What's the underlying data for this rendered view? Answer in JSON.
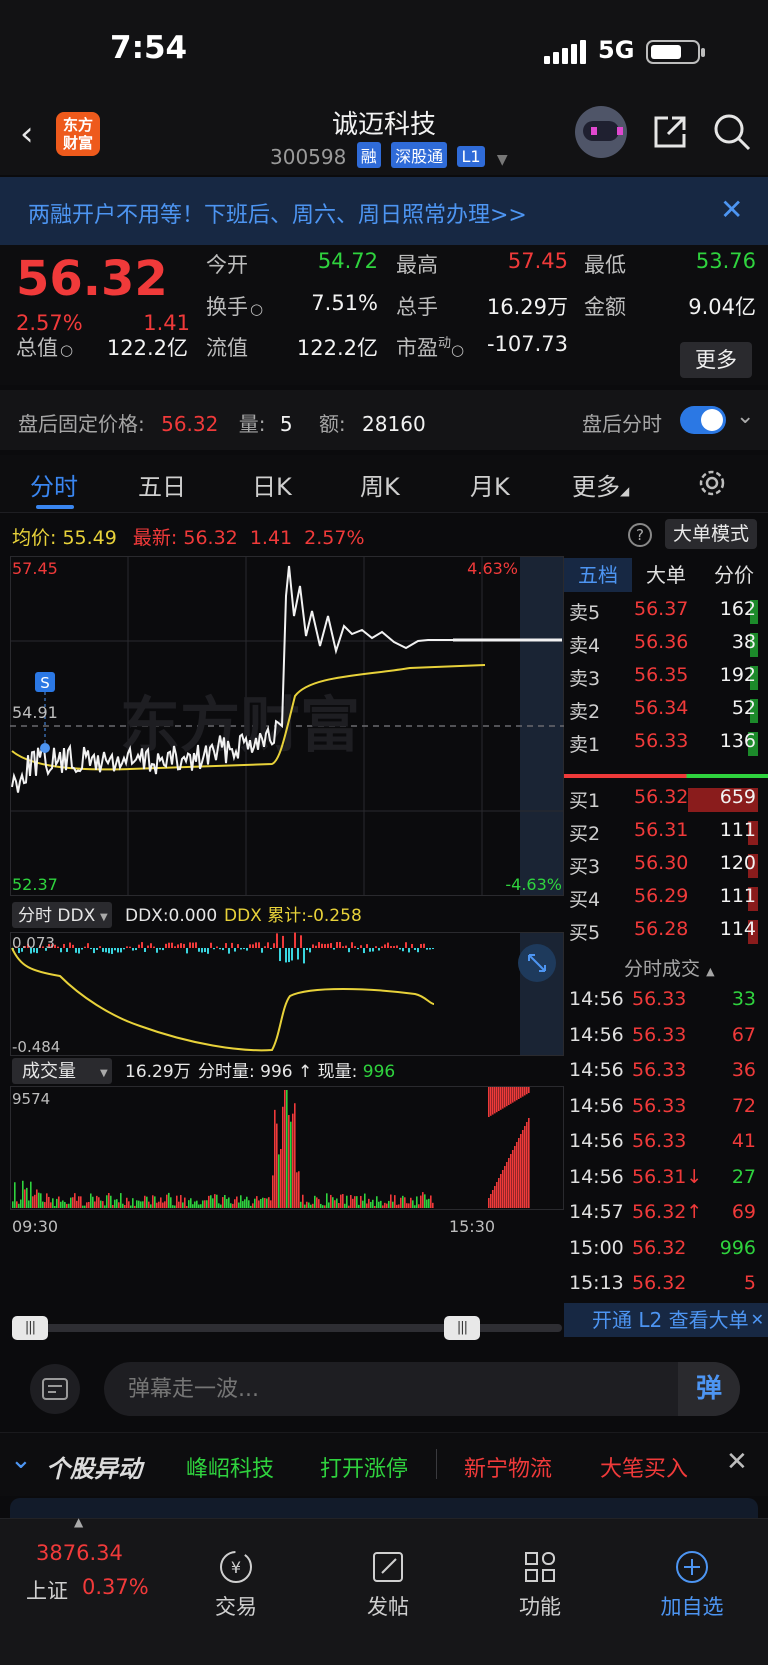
{
  "status_bar": {
    "time": "7:54",
    "network": "5G"
  },
  "header": {
    "title": "诚迈科技",
    "code": "300598",
    "tags": [
      "融",
      "深股通",
      "L1"
    ],
    "logo_text": "东方财富"
  },
  "banner": {
    "text": "两融开户不用等！下班后、周六、周日照常办理>>"
  },
  "quote": {
    "price": "56.32",
    "change_pct": "2.57%",
    "change": "1.41",
    "fields": [
      {
        "label": "今开",
        "value": "54.72",
        "color": "green"
      },
      {
        "label": "最高",
        "value": "57.45",
        "color": "red"
      },
      {
        "label": "最低",
        "value": "53.76",
        "color": "green"
      },
      {
        "label": "换手",
        "value": "7.51%",
        "color": "white"
      },
      {
        "label": "总手",
        "value": "16.29万",
        "color": "white"
      },
      {
        "label": "金额",
        "value": "9.04亿",
        "color": "white"
      },
      {
        "label": "总值",
        "value": "122.2亿",
        "color": "white"
      },
      {
        "label": "流值",
        "value": "122.2亿",
        "color": "white"
      },
      {
        "label": "市盈",
        "sup": "动",
        "value": "-107.73",
        "color": "white"
      }
    ],
    "more_label": "更多"
  },
  "after_hours": {
    "label": "盘后固定价格:",
    "price": "56.32",
    "vol_label": "量:",
    "vol": "5",
    "amt_label": "额:",
    "amt": "28160",
    "toggle_label": "盘后分时",
    "toggle_on": true
  },
  "tabs": [
    "分时",
    "五日",
    "日K",
    "周K",
    "月K",
    "更多"
  ],
  "active_tab": "分时",
  "info_bar": {
    "avg_label": "均价:",
    "avg": "55.49",
    "latest_label": "最新:",
    "latest": "56.32",
    "change": "1.41",
    "pct": "2.57%",
    "bigorder_label": "大单模式"
  },
  "chart": {
    "price_high": "57.45",
    "price_low": "52.37",
    "price_mid": "54.91",
    "pct_high": "4.63%",
    "pct_low": "-4.63%",
    "ddx_selector": "分时 DDX",
    "ddx_value": "DDX:0.000",
    "ddx_cum": "DDX 累计:-0.258",
    "ddx_high": "0.073",
    "ddx_low": "-0.484",
    "vol_selector": "成交量",
    "vol_total": "16.29万",
    "vol_time_label": "分时量: 996",
    "vol_now_label": "现量:",
    "vol_now": "996",
    "vol_max": "9574",
    "time_start": "09:30",
    "time_end": "15:30",
    "signal_badge": "S",
    "watermark": "东方财富"
  },
  "orderbook": {
    "tabs": [
      "五档",
      "大单",
      "分价"
    ],
    "asks": [
      {
        "label": "卖5",
        "price": "56.37",
        "vol": "162"
      },
      {
        "label": "卖4",
        "price": "56.36",
        "vol": "38"
      },
      {
        "label": "卖3",
        "price": "56.35",
        "vol": "192"
      },
      {
        "label": "卖2",
        "price": "56.34",
        "vol": "52"
      },
      {
        "label": "卖1",
        "price": "56.33",
        "vol": "136"
      }
    ],
    "bids": [
      {
        "label": "买1",
        "price": "56.32",
        "vol": "659"
      },
      {
        "label": "买2",
        "price": "56.31",
        "vol": "111"
      },
      {
        "label": "买3",
        "price": "56.30",
        "vol": "120"
      },
      {
        "label": "买4",
        "price": "56.29",
        "vol": "111"
      },
      {
        "label": "买5",
        "price": "56.28",
        "vol": "114"
      }
    ]
  },
  "trades": {
    "title": "分时成交",
    "rows": [
      {
        "time": "14:56",
        "price": "56.33",
        "vol": "33",
        "vcolor": "green"
      },
      {
        "time": "14:56",
        "price": "56.33",
        "vol": "67",
        "vcolor": "red"
      },
      {
        "time": "14:56",
        "price": "56.33",
        "vol": "36",
        "vcolor": "red"
      },
      {
        "time": "14:56",
        "price": "56.33",
        "vol": "72",
        "vcolor": "red"
      },
      {
        "time": "14:56",
        "price": "56.33",
        "vol": "41",
        "vcolor": "red"
      },
      {
        "time": "14:56",
        "price": "56.31↓",
        "vol": "27",
        "vcolor": "green"
      },
      {
        "time": "14:57",
        "price": "56.32↑",
        "vol": "69",
        "vcolor": "red"
      },
      {
        "time": "15:00",
        "price": "56.32",
        "vol": "996",
        "vcolor": "green"
      },
      {
        "time": "15:13",
        "price": "56.32",
        "vol": "5",
        "vcolor": "red"
      }
    ],
    "l2_label": "开通 L2 查看大单"
  },
  "danmaku": {
    "placeholder": "弹幕走一波...",
    "send_label": "弹"
  },
  "movement": {
    "title": "个股异动",
    "items": [
      {
        "text": "峰岹科技",
        "color": "green"
      },
      {
        "text": "打开涨停",
        "color": "green"
      },
      {
        "text": "新宁物流",
        "color": "red"
      },
      {
        "text": "大笔买入",
        "color": "red"
      }
    ]
  },
  "bottom_nav": {
    "index_value": "3876.34",
    "index_name": "上证",
    "index_pct": "0.37%",
    "items": [
      "交易",
      "发帖",
      "功能",
      "加自选"
    ]
  }
}
